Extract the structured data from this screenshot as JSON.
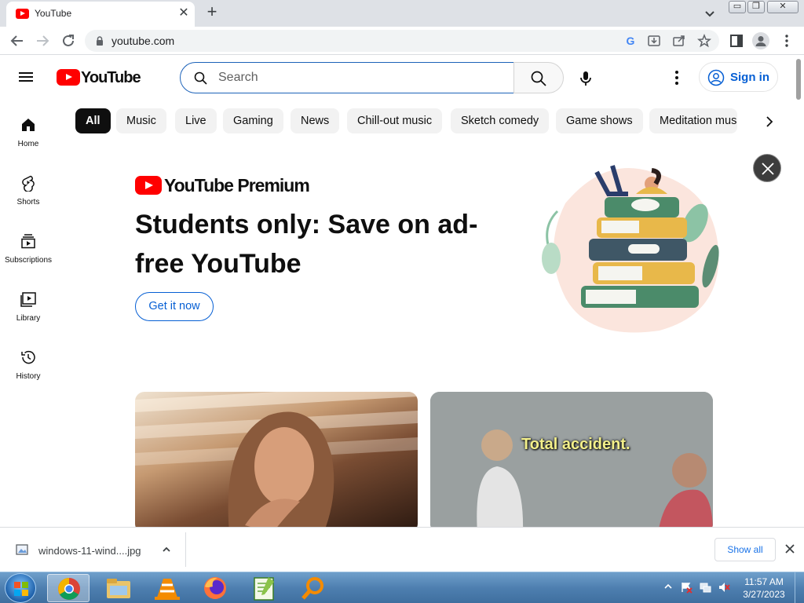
{
  "browser": {
    "tab_title": "YouTube",
    "url": "youtube.com",
    "tab_close_glyph": "✕",
    "new_tab_glyph": "+",
    "google_glyph": "G",
    "win_min_glyph": "▭",
    "win_max_glyph": "❐",
    "win_close_glyph": "✕",
    "icons": [
      "back-arrow-icon",
      "forward-arrow-icon",
      "reload-icon",
      "lock-icon",
      "google-icon",
      "install-icon",
      "share-icon",
      "star-icon",
      "side-panel-icon",
      "profile-icon",
      "kebab-menu-icon"
    ]
  },
  "youtube": {
    "logo_text": "YouTube",
    "search_placeholder": "Search",
    "sign_in_label": "Sign in",
    "chips": [
      "All",
      "Music",
      "Live",
      "Gaming",
      "News",
      "Chill-out music",
      "Sketch comedy",
      "Game shows",
      "Meditation mus"
    ],
    "active_chip": "All",
    "guide": [
      {
        "label": "Home",
        "icon": "home-icon"
      },
      {
        "label": "Shorts",
        "icon": "shorts-icon"
      },
      {
        "label": "Subscriptions",
        "icon": "subscriptions-icon"
      },
      {
        "label": "Library",
        "icon": "library-icon"
      },
      {
        "label": "History",
        "icon": "history-icon"
      }
    ],
    "promo": {
      "logo_text": "YouTube Premium",
      "headline": "Students only: Save on ad-free YouTube",
      "cta_label": "Get it now"
    },
    "videos": [
      {
        "caption": ""
      },
      {
        "caption": "Total accident."
      }
    ],
    "accent_color": "#ff0000",
    "link_color": "#065fd4"
  },
  "downloads": {
    "filename": "windows-11-wind....jpg",
    "show_all_label": "Show all"
  },
  "taskbar": {
    "time": "11:57 AM",
    "date": "3/27/2023",
    "apps": [
      "chrome-icon",
      "file-explorer-icon",
      "vlc-icon",
      "firefox-icon",
      "notepad-plus-plus-icon",
      "search-magnifier-icon"
    ]
  }
}
